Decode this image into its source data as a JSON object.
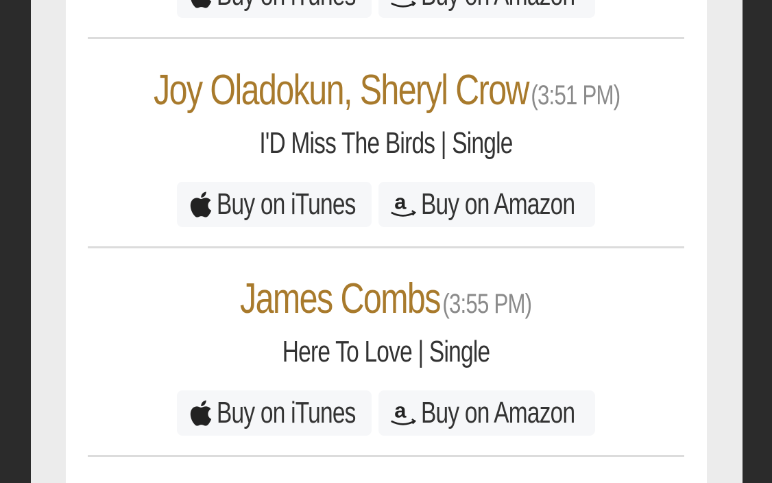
{
  "entries": [
    {
      "itunes_label": "Buy on iTunes",
      "amazon_label": "Buy on Amazon"
    },
    {
      "artist": "Joy Oladokun, Sheryl Crow",
      "time": "(3:51 PM)",
      "album": "I'D Miss The Birds | Single",
      "itunes_label": "Buy on iTunes",
      "amazon_label": "Buy on Amazon"
    },
    {
      "artist": "James Combs",
      "time": "(3:55 PM)",
      "album": "Here To Love | Single",
      "itunes_label": "Buy on iTunes",
      "amazon_label": "Buy on Amazon"
    }
  ],
  "icons": {
    "itunes": "apple-icon",
    "amazon": "amazon-icon"
  },
  "colors": {
    "artist": "#a87a2c",
    "time": "#8a8a8a",
    "text": "#333333",
    "button_bg": "#f6f7f9",
    "divider": "#dcdcdc"
  }
}
